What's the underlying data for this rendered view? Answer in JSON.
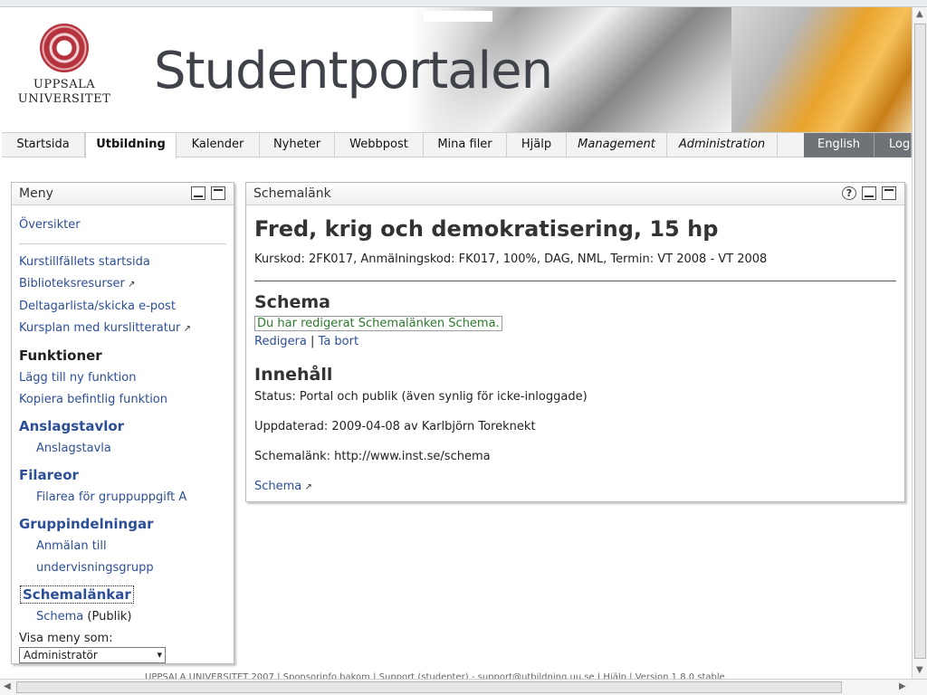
{
  "header": {
    "logo_line1": "UPPSALA",
    "logo_line2": "UNIVERSITET",
    "title": "Studentportalen"
  },
  "tabs": [
    {
      "label": "Startsida"
    },
    {
      "label": "Utbildning",
      "active": true
    },
    {
      "label": "Kalender"
    },
    {
      "label": "Nyheter"
    },
    {
      "label": "Webbpost"
    },
    {
      "label": "Mina filer"
    },
    {
      "label": "Hjälp"
    },
    {
      "label": "Management"
    },
    {
      "label": "Administration"
    },
    {
      "label": "English"
    },
    {
      "label": "Log"
    }
  ],
  "menu": {
    "title": "Meny",
    "overview": "Översikter",
    "links": [
      "Kurstillfällets startsida",
      "Biblioteksresurser",
      "Deltagarlista/skicka e-post",
      "Kursplan med kurslitteratur"
    ],
    "functions_heading": "Funktioner",
    "function_links": [
      "Lägg till ny funktion",
      "Kopiera befintlig funktion"
    ],
    "sections": [
      {
        "heading": "Anslagstavlor",
        "item": "Anslagstavla"
      },
      {
        "heading": "Filareor",
        "item": "Filarea för gruppuppgift A"
      },
      {
        "heading": "Gruppindelningar",
        "item": "Anmälan till undervisningsgrupp"
      },
      {
        "heading": "Schemalänkar",
        "item": "Schema",
        "suffix": "(Publik)"
      }
    ],
    "show_as_label": "Visa meny som:",
    "show_as_value": "Administratör"
  },
  "main": {
    "panel_title": "Schemalänk",
    "course_title": "Fred, krig och demokratisering, 15 hp",
    "course_info": "Kurskod: 2FK017, Anmälningskod: FK017, 100%, DAG, NML, Termin: VT 2008 - VT 2008",
    "schema_heading": "Schema",
    "notice": "Du har redigerat Schemalänken Schema.",
    "edit_label": "Redigera",
    "separator": "|",
    "delete_label": "Ta bort",
    "content_heading": "Innehåll",
    "status": "Status: Portal och publik (även synlig för icke-inloggade)",
    "updated": "Uppdaterad: 2009-04-08 av Karlbjörn Toreknekt",
    "link_text": "Schemalänk: http://www.inst.se/schema",
    "schema_link": "Schema"
  },
  "footer": {
    "text": "UPPSALA UNIVERSITET 2007 | Sponsorinfo bakom | Support (studenter) - support@utbildning.uu.se | Hjälp | Version 1.8.0 stable"
  },
  "colors": {
    "link": "#2c4f97",
    "notice": "#2b7a2b",
    "tab_dark": "#6f7277"
  }
}
